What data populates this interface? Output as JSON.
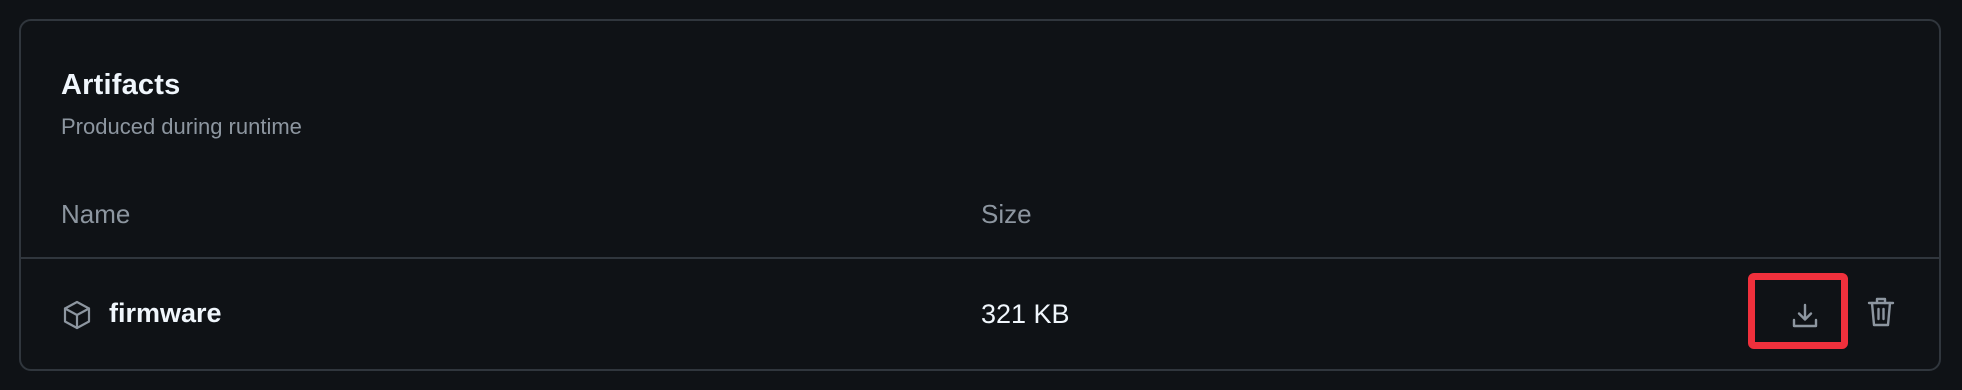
{
  "section": {
    "title": "Artifacts",
    "subtitle": "Produced during runtime"
  },
  "table": {
    "columns": [
      "Name",
      "Size"
    ],
    "rows": [
      {
        "icon": "package-icon",
        "name": "firmware",
        "size": "321 KB",
        "actions": [
          "download-icon",
          "trash-icon"
        ]
      }
    ]
  },
  "colors": {
    "background": "#0f1216",
    "border": "#30363d",
    "text_primary": "#f0f6fc",
    "text_muted": "#8d96a0",
    "highlight": "#f0303c"
  }
}
